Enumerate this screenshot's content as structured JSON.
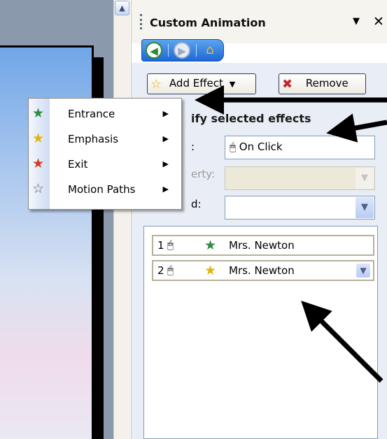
{
  "pane": {
    "title": "Custom Animation",
    "menu_glyph": "▼",
    "close_glyph": "✕"
  },
  "navigation": {
    "back_glyph": "◀",
    "forward_glyph": "▶",
    "home_glyph": "⌂"
  },
  "toolbar": {
    "add_effect_label": "Add Effect",
    "add_effect_icon": "☆",
    "remove_label": "Remove",
    "remove_icon": "✖"
  },
  "section": {
    "title": "ify selected effects"
  },
  "properties": {
    "start_label": ":",
    "property_label": "erty:",
    "speed_label": "d:",
    "start_value": "On Click",
    "start_icon": "🖱",
    "property_value": "",
    "speed_value": ""
  },
  "effects": [
    {
      "number": "1",
      "name": "Mrs. Newton",
      "icon": "star-entrance-icon"
    },
    {
      "number": "2",
      "name": "Mrs. Newton",
      "icon": "star-emphasis-icon"
    }
  ],
  "menu": {
    "items": [
      {
        "label": "Entrance",
        "icon": "entrance-star-icon",
        "color": "#2e8b3e"
      },
      {
        "label": "Emphasis",
        "icon": "emphasis-star-icon",
        "color": "#e2b40c"
      },
      {
        "label": "Exit",
        "icon": "exit-star-icon",
        "color": "#d63a1e"
      },
      {
        "label": "Motion Paths",
        "icon": "motion-path-star-icon",
        "color": "#666666"
      }
    ]
  },
  "colors": {
    "nav_toolbar": "#1d68d6",
    "pane_body": "#e9edf5",
    "slide_top": "#70a6e8"
  }
}
